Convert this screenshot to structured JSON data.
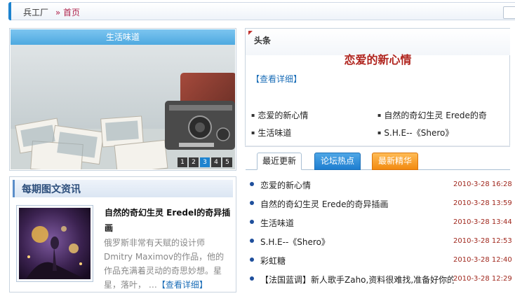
{
  "breadcrumb": {
    "site": "兵工厂",
    "sep": "»",
    "home": "首页"
  },
  "slideshow": {
    "title": "生活味道",
    "pages": [
      "1",
      "2",
      "3",
      "4",
      "5"
    ],
    "active_index": 3
  },
  "headline": {
    "label": "头条",
    "title": "恋爱的新心情",
    "more_link": "【查看详细】",
    "items": [
      "恋爱的新心情",
      "自然的奇幻生灵 Erede的奇",
      "生活味道",
      "S.H.E--《Shero》"
    ]
  },
  "tabs": {
    "recent": "最近更新",
    "forum": "论坛热点",
    "best": "最新精华"
  },
  "news": [
    {
      "title": "恋爱的新心情",
      "date": "2010-3-28 16:28"
    },
    {
      "title": "自然的奇幻生灵 Erede的奇异插画",
      "date": "2010-3-28 13:59"
    },
    {
      "title": "生活味道",
      "date": "2010-3-28 13:44"
    },
    {
      "title": "S.H.E--《Shero》",
      "date": "2010-3-28 12:53"
    },
    {
      "title": "彩虹糖",
      "date": "2010-3-28 12:40"
    },
    {
      "title": "【法国蓝调】新人歌手Zaho,资料很难找,准备好你的",
      "date": "2010-3-28 12:29"
    }
  ],
  "periodical": {
    "header": "每期图文资讯",
    "title": "自然的奇幻生灵 Eredel的奇异插画",
    "text": "俄罗斯非常有天赋的设计师Dmitry Maximov的作品，他的作品充满着灵动的奇思妙想。星星，落叶，",
    "ellipsis": "…",
    "more": "【查看详细】"
  },
  "colors": {
    "accent_blue": "#1d83cf",
    "headline_red": "#b0251f",
    "date_red": "#a0281e",
    "tab_orange": "#f28a10"
  }
}
